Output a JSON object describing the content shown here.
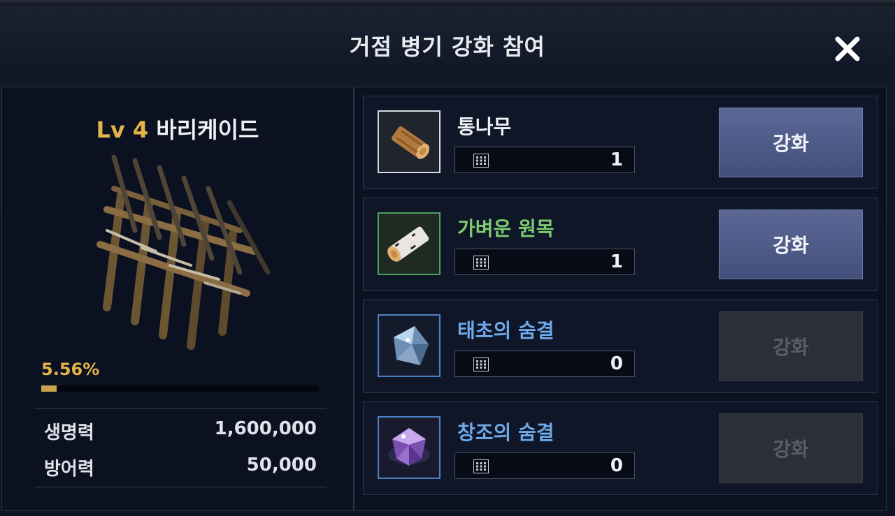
{
  "dialog": {
    "title": "거점 병기 강화 참여"
  },
  "weapon": {
    "level": "Lv 4",
    "name": "바리케이드",
    "progress_text": "5.56%",
    "progress_fraction": 0.0556,
    "stats": [
      {
        "label": "생명력",
        "value": "1,600,000"
      },
      {
        "label": "방어력",
        "value": "50,000"
      }
    ]
  },
  "materials": [
    {
      "name": "통나무",
      "quantity": "1",
      "name_color": "#eef0f4",
      "frame_color": "#d8dadf",
      "icon": "log-icon",
      "button_label": "강화",
      "enabled": true
    },
    {
      "name": "가벼운 원목",
      "quantity": "1",
      "name_color": "#7ecb6e",
      "frame_color": "#4fa35a",
      "icon": "birch-log-icon",
      "button_label": "강화",
      "enabled": true
    },
    {
      "name": "태초의 숨결",
      "quantity": "0",
      "name_color": "#6ea8e8",
      "frame_color": "#4d7fc6",
      "icon": "crystal-icon",
      "button_label": "강화",
      "enabled": false
    },
    {
      "name": "창조의 숨결",
      "quantity": "0",
      "name_color": "#6ea8e8",
      "frame_color": "#4d7fc6",
      "icon": "purple-gem-icon",
      "button_label": "강화",
      "enabled": false
    }
  ],
  "colors": {
    "accent_gold": "#e2b44a",
    "button_enabled": "#4f5b89",
    "button_disabled": "#2c2f37"
  }
}
